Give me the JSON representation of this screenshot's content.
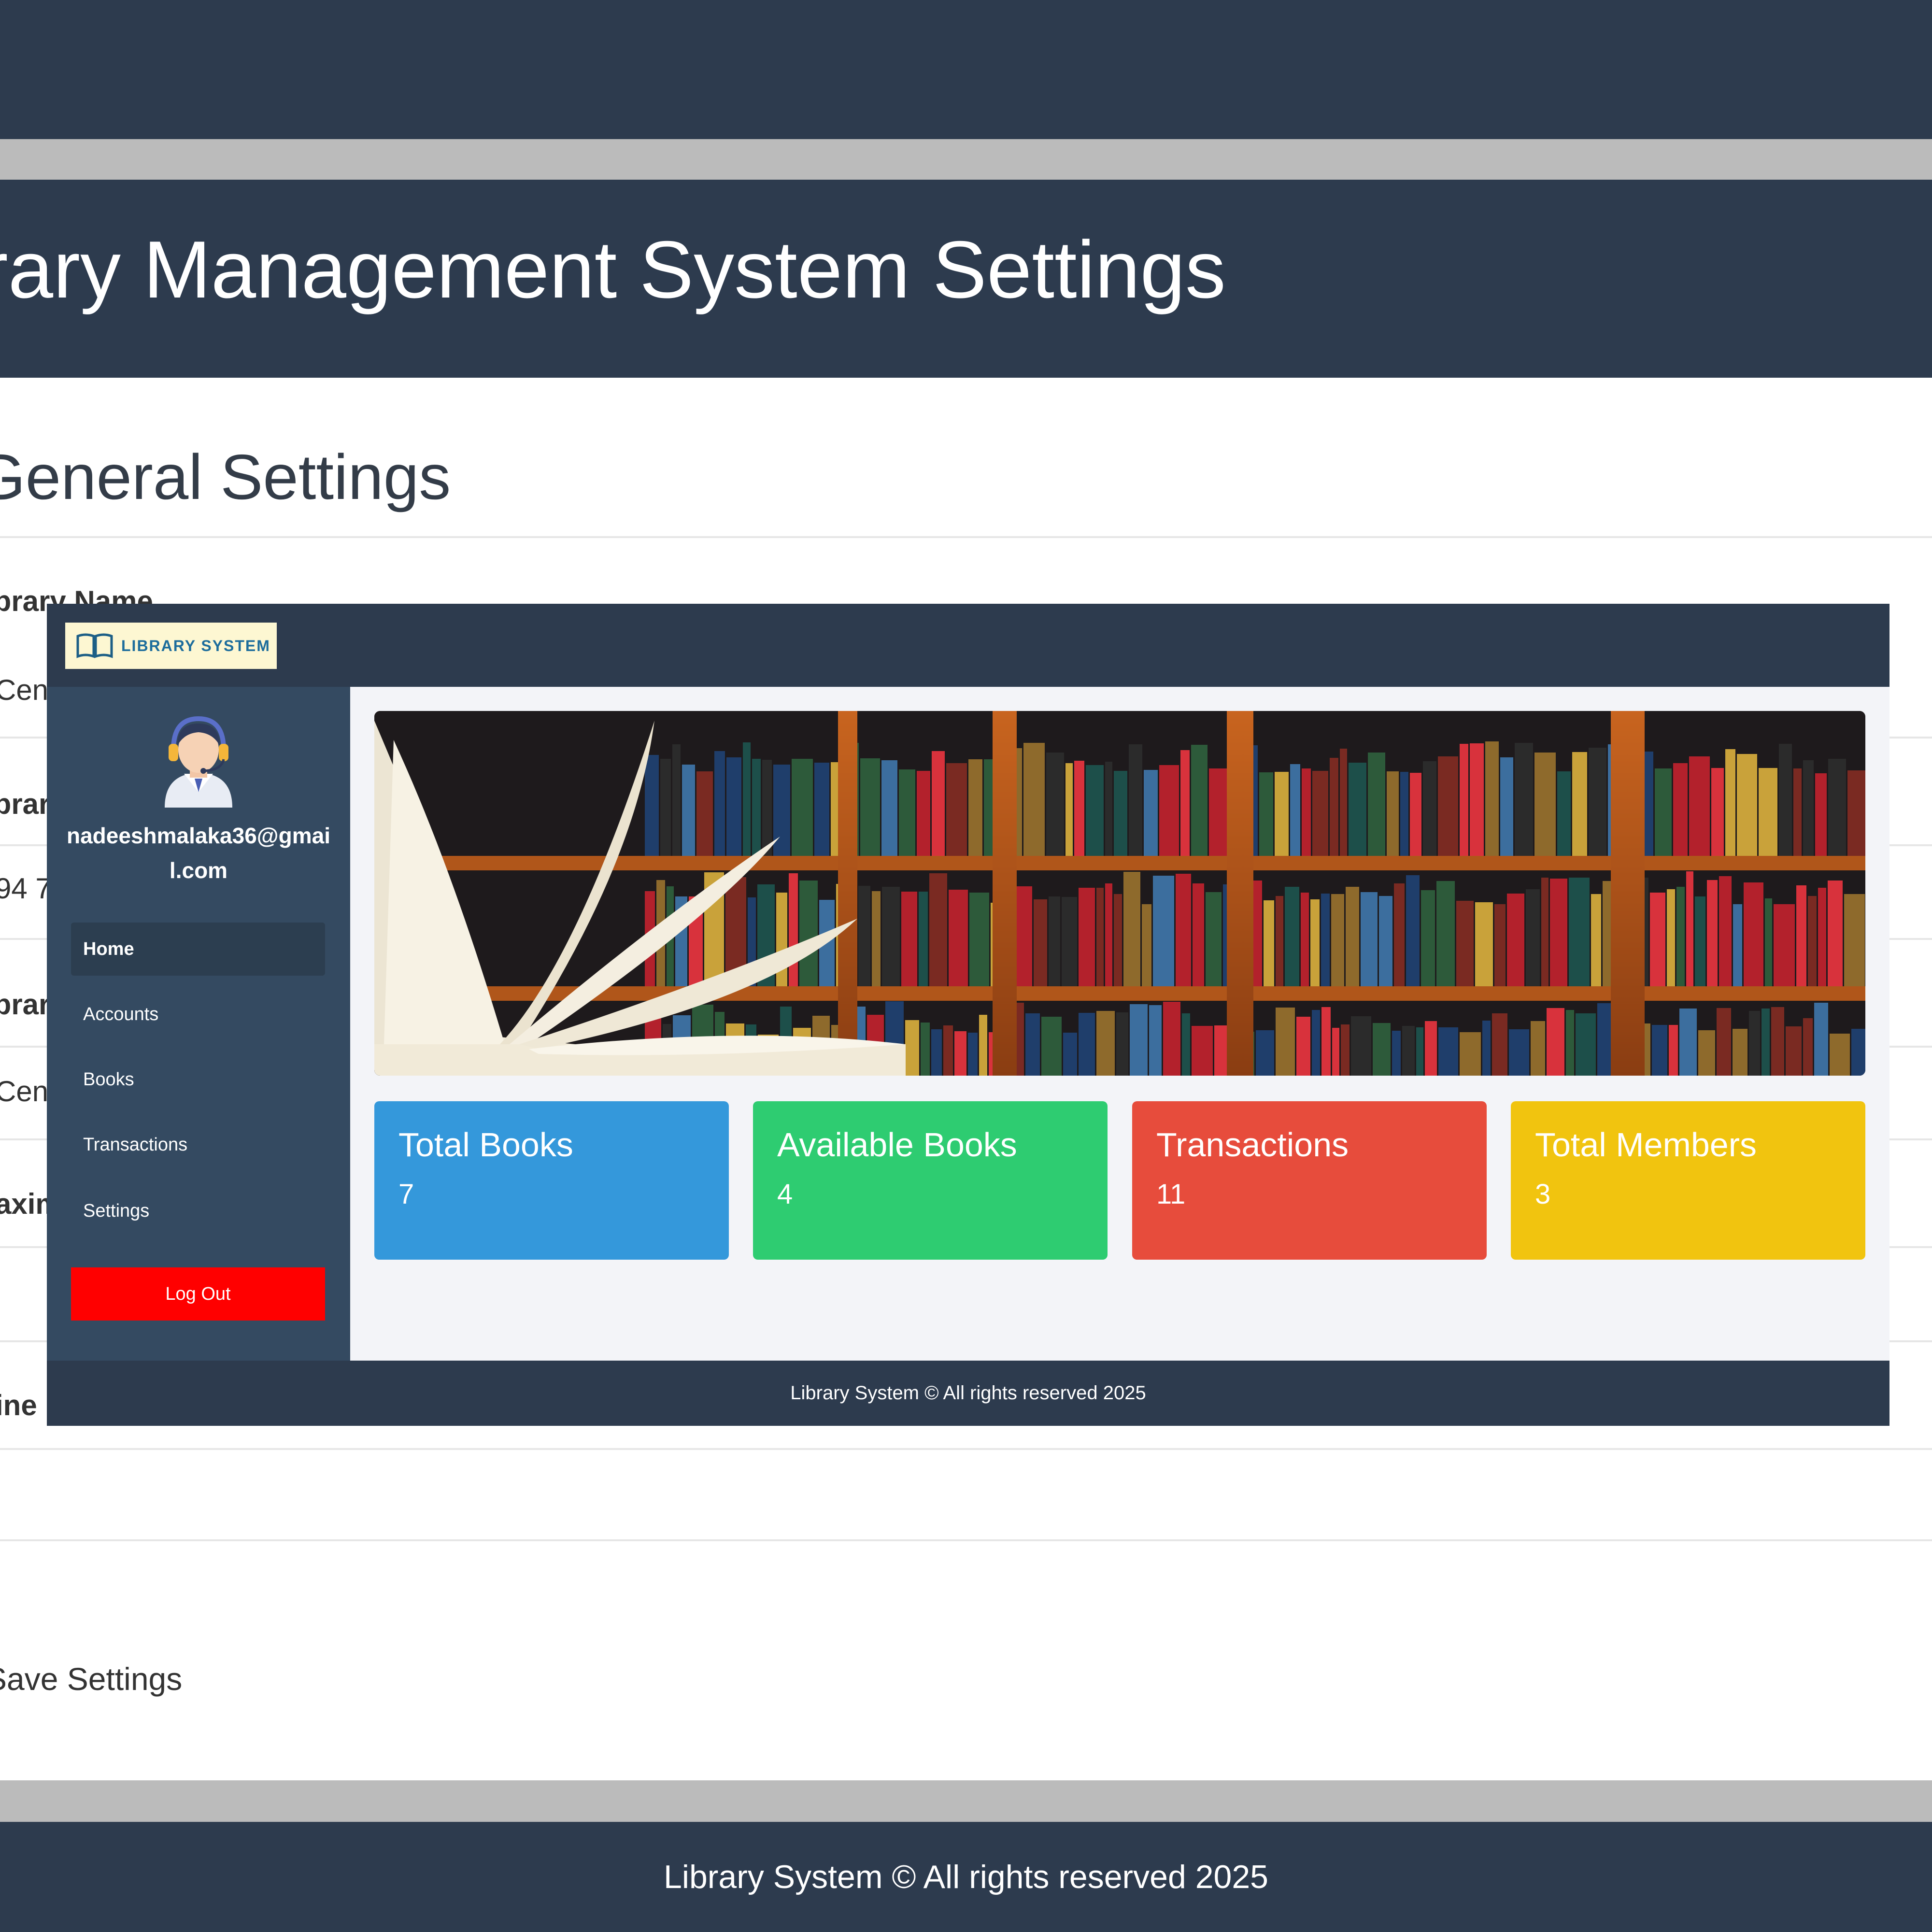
{
  "background_page": {
    "header_title": "ibrary Management System Settings",
    "section_title": "General Settings",
    "partial_labels": [
      "ibrary Name",
      "ibrary",
      "ibrary",
      "aximum",
      "ine R"
    ],
    "partial_values": [
      "Centr",
      "94 7",
      "Centr"
    ],
    "save_button_label": "Save Settings",
    "footer_text": "Library System © All rights reserved 2025"
  },
  "dashboard": {
    "logo_text": "LIBRARY SYSTEM",
    "user_email": "nadeeshmalaka36@gmail.com",
    "nav": [
      {
        "label": "Home",
        "active": true
      },
      {
        "label": "Accounts",
        "active": false
      },
      {
        "label": "Books",
        "active": false
      },
      {
        "label": "Transactions",
        "active": false
      },
      {
        "label": "Settings",
        "active": false
      }
    ],
    "logout_label": "Log Out",
    "stats": [
      {
        "title": "Total Books",
        "value": "7",
        "color": "#3498db"
      },
      {
        "title": "Available Books",
        "value": "4",
        "color": "#2ecc71"
      },
      {
        "title": "Transactions",
        "value": "11",
        "color": "#e74c3c"
      },
      {
        "title": "Total Members",
        "value": "3",
        "color": "#f1c40f"
      }
    ],
    "footer_text": "Library System © All rights reserved 2025"
  },
  "colors": {
    "navy": "#2d3b4e",
    "sidebar": "#344a61",
    "logout_red": "#ff0000"
  },
  "icons": {
    "logo": "open-book-icon",
    "avatar": "support-agent-avatar-icon",
    "banner": "library-bookshelf-image"
  }
}
